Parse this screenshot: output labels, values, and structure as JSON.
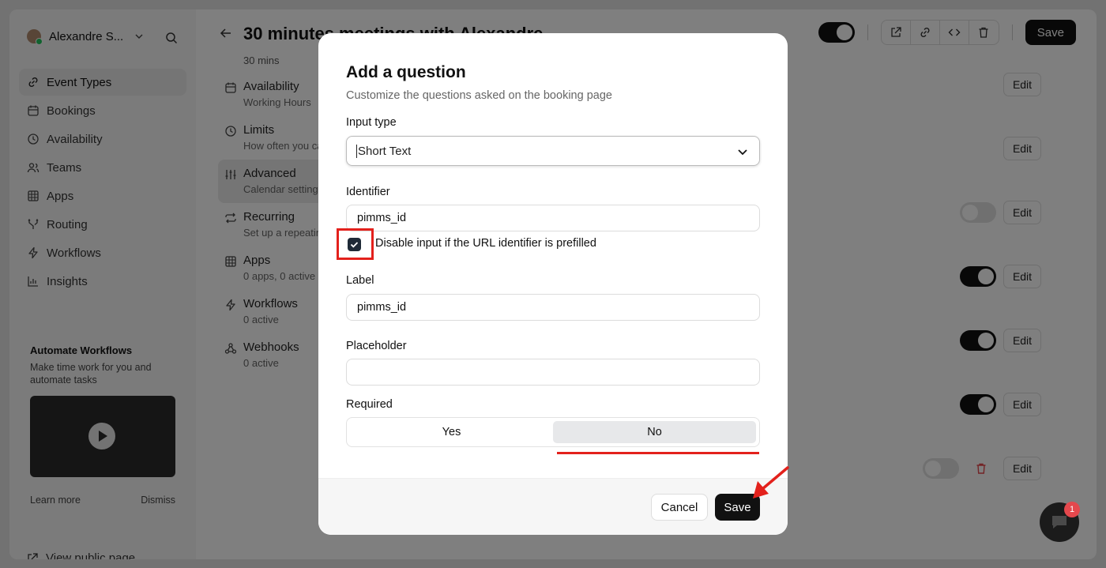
{
  "sidebar": {
    "user_name": "Alexandre S...",
    "nav": [
      {
        "label": "Event Types",
        "icon": "link-icon",
        "active": true
      },
      {
        "label": "Bookings",
        "icon": "calendar-icon"
      },
      {
        "label": "Availability",
        "icon": "clock-icon"
      },
      {
        "label": "Teams",
        "icon": "users-icon"
      },
      {
        "label": "Apps",
        "icon": "grid-icon"
      },
      {
        "label": "Routing",
        "icon": "split-icon"
      },
      {
        "label": "Workflows",
        "icon": "zap-icon"
      },
      {
        "label": "Insights",
        "icon": "bar-chart-icon"
      }
    ],
    "promo": {
      "title": "Automate Workflows",
      "text": "Make time work for you and automate tasks",
      "learn_more": "Learn more",
      "dismiss": "Dismiss"
    },
    "view_public": "View public page"
  },
  "header": {
    "title": "30 minutes meetings with Alexandre",
    "subtitle": "30 mins",
    "save_label": "Save"
  },
  "sections": [
    {
      "title": "Availability",
      "desc": "Working Hours",
      "icon": "calendar-icon"
    },
    {
      "title": "Limits",
      "desc": "How often you can be booked",
      "icon": "clock-icon"
    },
    {
      "title": "Advanced",
      "desc": "Calendar settings & more",
      "icon": "sliders-icon",
      "active": true
    },
    {
      "title": "Recurring",
      "desc": "Set up a repeating schedule",
      "icon": "repeat-icon"
    },
    {
      "title": "Apps",
      "desc": "0 apps, 0 active",
      "icon": "grid-icon"
    },
    {
      "title": "Workflows",
      "desc": "0 active",
      "icon": "zap-icon"
    },
    {
      "title": "Webhooks",
      "desc": "0 active",
      "icon": "webhook-icon"
    }
  ],
  "rows": {
    "edit_label": "Edit"
  },
  "modal": {
    "title": "Add a question",
    "subtitle": "Customize the questions asked on the booking page",
    "input_type_label": "Input type",
    "input_type_value": "Short Text",
    "identifier_label": "Identifier",
    "identifier_value": "pimms_id",
    "checkbox_label": "Disable input if the URL identifier is prefilled",
    "checkbox_checked": true,
    "label_label": "Label",
    "label_value": "pimms_id",
    "placeholder_label": "Placeholder",
    "placeholder_value": "",
    "required_label": "Required",
    "required_options": [
      "Yes",
      "No"
    ],
    "required_selected": "No",
    "cancel_label": "Cancel",
    "save_label": "Save"
  },
  "chat": {
    "badge_count": "1"
  },
  "colors": {
    "annotation_red": "#e3211c",
    "primary": "#111111",
    "badge_red": "#e5484d"
  }
}
